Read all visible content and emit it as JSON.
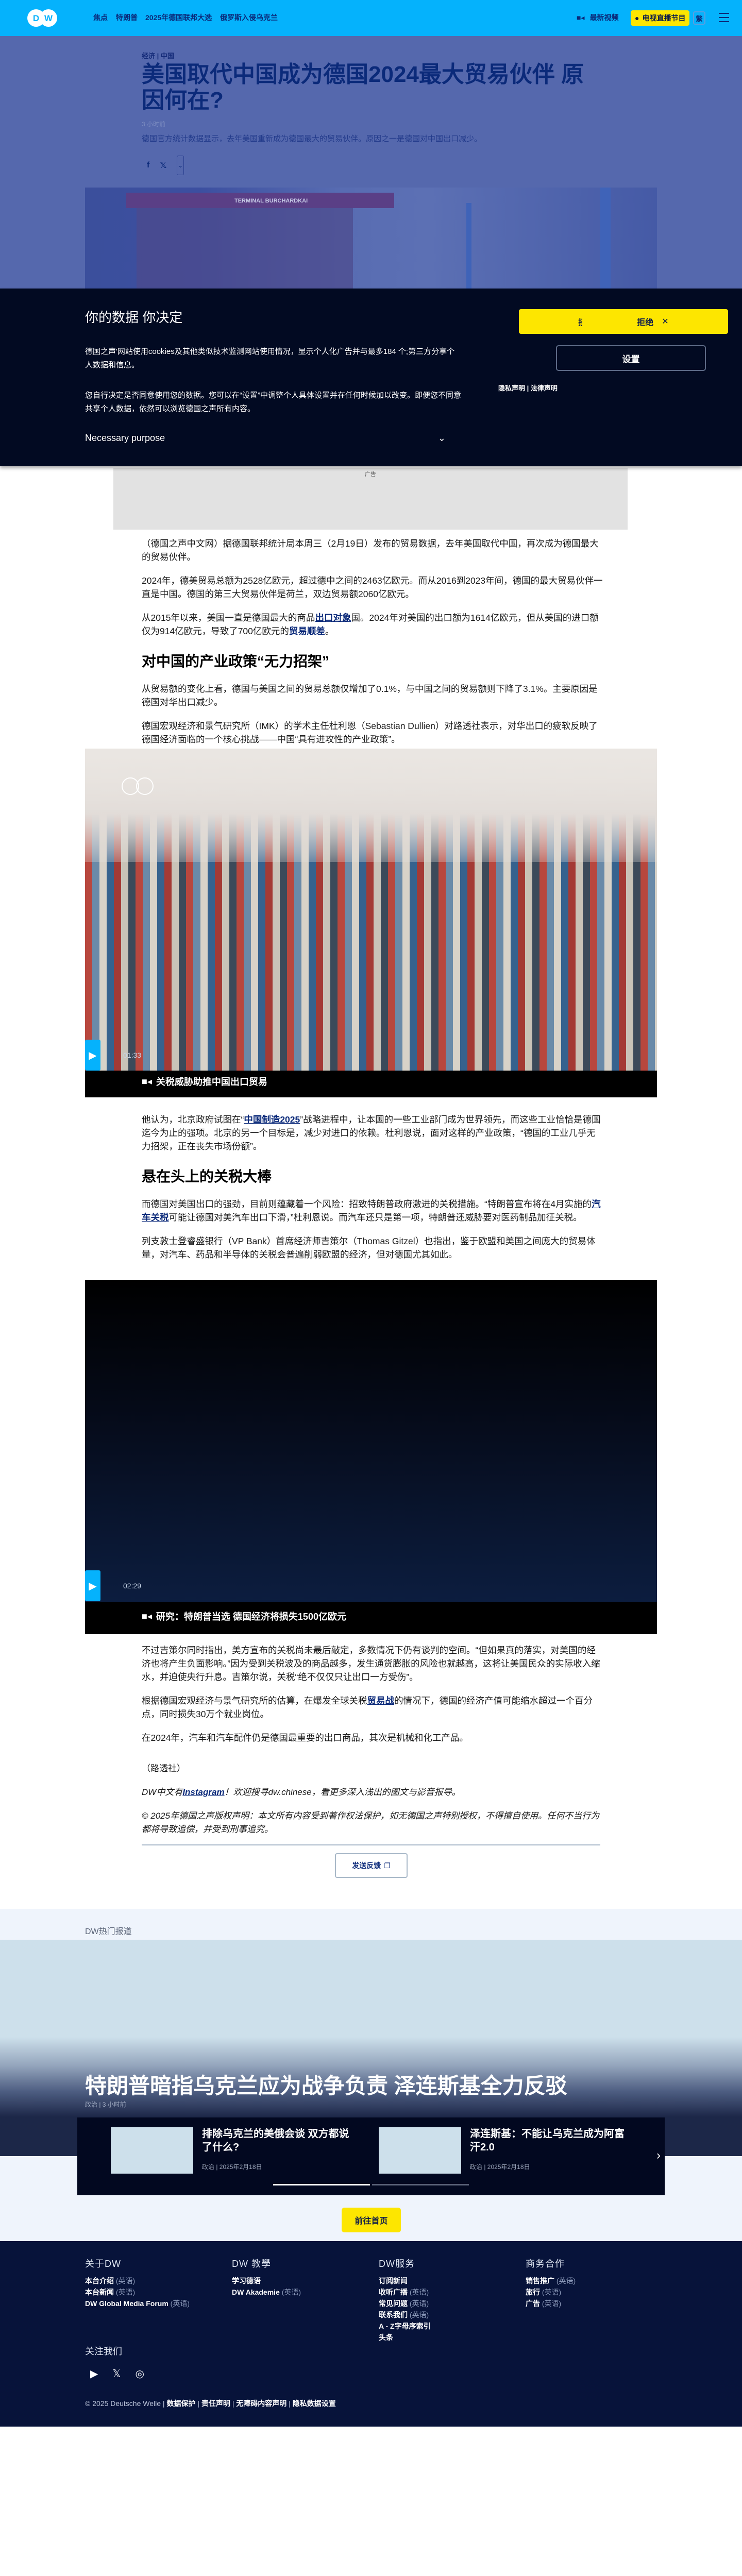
{
  "header": {
    "logo": "DW",
    "nav": [
      "焦点",
      "特朗普",
      "2025年德国联邦大选",
      "俄罗斯入侵乌克兰"
    ],
    "latest_videos": "最新视频",
    "tv_live": "电视直播节目",
    "lang_toggle": "繁"
  },
  "hero": {
    "kicker_1": "经济",
    "kicker_2": "中国",
    "title": "美国取代中国成为德国2024最大贸易伙伴 原因何在?",
    "time": "3 小时前",
    "lede": "德国官方统计数据显示，去年美国重新成为德国最大的贸易伙伴。原因之一是德国对中国出口减少。",
    "image_text": "TERMINAL BURCHARDKAI"
  },
  "cookie": {
    "title": "你的数据 你决定",
    "p1": "德国之声'网站使用cookies及其他类似技术监测网站使用情况，显示个人化广告并与最多184 个;第三方分享个人数据和信息。",
    "p2": "您自行决定是否同意使用您的数据。您可以在“设置”中调整个人具体设置并在任何时候加以改变。即便您不同意共享个人数据，依然可以浏览德国之声所有内容。",
    "necessary": "Necessary purpose",
    "accept_partial": "接",
    "reject": "拒绝",
    "settings": "设置",
    "privacy": "隐私声明",
    "legal": "法律声明"
  },
  "article": {
    "ad_label": "广告",
    "p1": "（德国之声中文网）据德国联邦统计局本周三（2月19日）发布的贸易数据，去年美国取代中国，再次成为德国最大的贸易伙伴。",
    "p2": "2024年，德美贸易总额为2528亿欧元，超过德中之间的2463亿欧元。而从2016到2023年间，德国的最大贸易伙伴一直是中国。德国的第三大贸易伙伴是荷兰，双边贸易额2060亿欧元。",
    "p3a": "从2015年以来，美国一直是德国最大的商品",
    "p3link": "出口对象",
    "p3b": "国。2024年对美国的出口额为1614亿欧元，但从美国的进口额仅为914亿欧元，导致了700亿欧元的",
    "p3link2": "贸易顺差",
    "p3c": "。",
    "h1": "对中国的产业政策“无力招架”",
    "p4": "从贸易额的变化上看，德国与美国之间的贸易总额仅增加了0.1%，与中国之间的贸易额则下降了3.1%。主要原因是德国对华出口减少。",
    "p5": "德国宏观经济和景气研究所（IMK）的学术主任杜利恩（Sebastian Dullien）对路透社表示，对华出口的疲软反映了德国经济面临的一个核心挑战——中国“具有进攻性的产业政策”。",
    "video1": {
      "duration": "01:33",
      "caption": "关税威胁助推中国出口贸易"
    },
    "p6a": "他认为，北京政府试图在“",
    "p6link": "中国制造2025",
    "p6b": "”战略进程中，让本国的一些工业部门成为世界领先，而这些工业恰恰是德国迄今为止的强项。北京的另一个目标是，减少对进口的依赖。杜利恩说，面对这样的产业政策，“德国的工业几乎无力招架，正在丧失市场份额”。",
    "h2": "悬在头上的关税大棒",
    "p7a": "而德国对美国出口的强劲，目前则蕴藏着一个风险：招致特朗普政府激进的关税措施。“特朗普宣布将在4月实施的",
    "p7link": "汽车关税",
    "p7b": "可能让德国对美汽车出口下滑，”杜利恩说。而汽车还只是第一项，特朗普还威胁要对医药制品加征关税。",
    "p8": "列支敦士登睿盛银行（VP Bank）首席经济师吉策尔（Thomas Gitzel）也指出，鉴于欧盟和美国之间庞大的贸易体量，对汽车、药品和半导体的关税会普遍削弱欧盟的经济，但对德国尤其如此。",
    "video2": {
      "duration": "02:29",
      "caption": "研究：特朗普当选 德国经济将损失1500亿欧元"
    },
    "p9": "不过吉策尔同时指出，美方宣布的关税尚未最后敲定，多数情况下仍有谈判的空间。“但如果真的落实，对美国的经济也将产生负面影响。”因为受到关税波及的商品越多，发生通货膨胀的风险也就越高，这将让美国民众的实际收入缩水，并迫使央行升息。吉策尔说，关税“绝不仅仅只让出口一方受伤”。",
    "p10a": "根据德国宏观经济与景气研究所的估算，在爆发全球关税",
    "p10link": "贸易战",
    "p10b": "的情况下，德国的经济产值可能缩水超过一个百分点，同时损失30万个就业岗位。",
    "p11": "在2024年，汽车和汽车配件仍是德国最重要的出口商品，其次是机械和化工产品。",
    "source": "（路透社）",
    "insta_a": "DW中文有",
    "insta_link": "Instagram",
    "insta_b": "！欢迎搜寻dw.chinese，看更多深入浅出的图文与影音报导。",
    "copyright": "© 2025年德国之声版权声明：本文所有内容受到著作权法保护，如无德国之声特别授权，不得擅自使用。任何不当行为都将导致追偿，并受到刑事追究。",
    "feedback": "发送反馈"
  },
  "top_stories": {
    "label": "DW热门报道",
    "hero_title": "特朗普暗指乌克兰应为战争负责 泽连斯基全力反驳",
    "hero_meta": "政治 | 3 小时前",
    "cards": [
      {
        "title": "排除乌克兰的美俄会谈 双方都说了什么?",
        "meta": "政治 | 2025年2月18日"
      },
      {
        "title": "泽连斯基：不能让乌克兰成为阿富汗2.0",
        "meta": "政治 | 2025年2月18日"
      }
    ],
    "carousel_progress": 0.5,
    "home_button": "前往首页"
  },
  "footer": {
    "columns": [
      {
        "title": "关于DW",
        "links": [
          {
            "t": "本台介绍",
            "s": "(英语)"
          },
          {
            "t": "本台新闻",
            "s": "(英语)"
          },
          {
            "t": "DW Global Media Forum",
            "s": "(英语)"
          }
        ]
      },
      {
        "title": "DW 教學",
        "links": [
          {
            "t": "学习德语",
            "s": ""
          },
          {
            "t": "DW Akademie",
            "s": "(英语)"
          }
        ]
      },
      {
        "title": "DW服务",
        "links": [
          {
            "t": "订阅新闻",
            "s": ""
          },
          {
            "t": "收听广播",
            "s": "(英语)"
          },
          {
            "t": "常见问题",
            "s": "(英语)"
          },
          {
            "t": "联系我们",
            "s": "(英语)"
          },
          {
            "t": "A - Z字母序索引",
            "s": ""
          },
          {
            "t": "头条",
            "s": ""
          }
        ]
      },
      {
        "title": "商务合作",
        "links": [
          {
            "t": "销售推广",
            "s": "(英语)"
          },
          {
            "t": "旅行",
            "s": "(英语)"
          },
          {
            "t": "广告",
            "s": "(英语)"
          }
        ]
      }
    ],
    "follow": "关注我们",
    "copyright": "© 2025 Deutsche Welle",
    "legal_links": [
      "数据保护",
      "责任声明",
      "无障碍内容声明",
      "隐私数据设置"
    ]
  },
  "colors": {
    "header": "#05b2fc",
    "accent_yellow": "#fde600",
    "navy": "#07133a",
    "link": "#0b2a7a"
  }
}
